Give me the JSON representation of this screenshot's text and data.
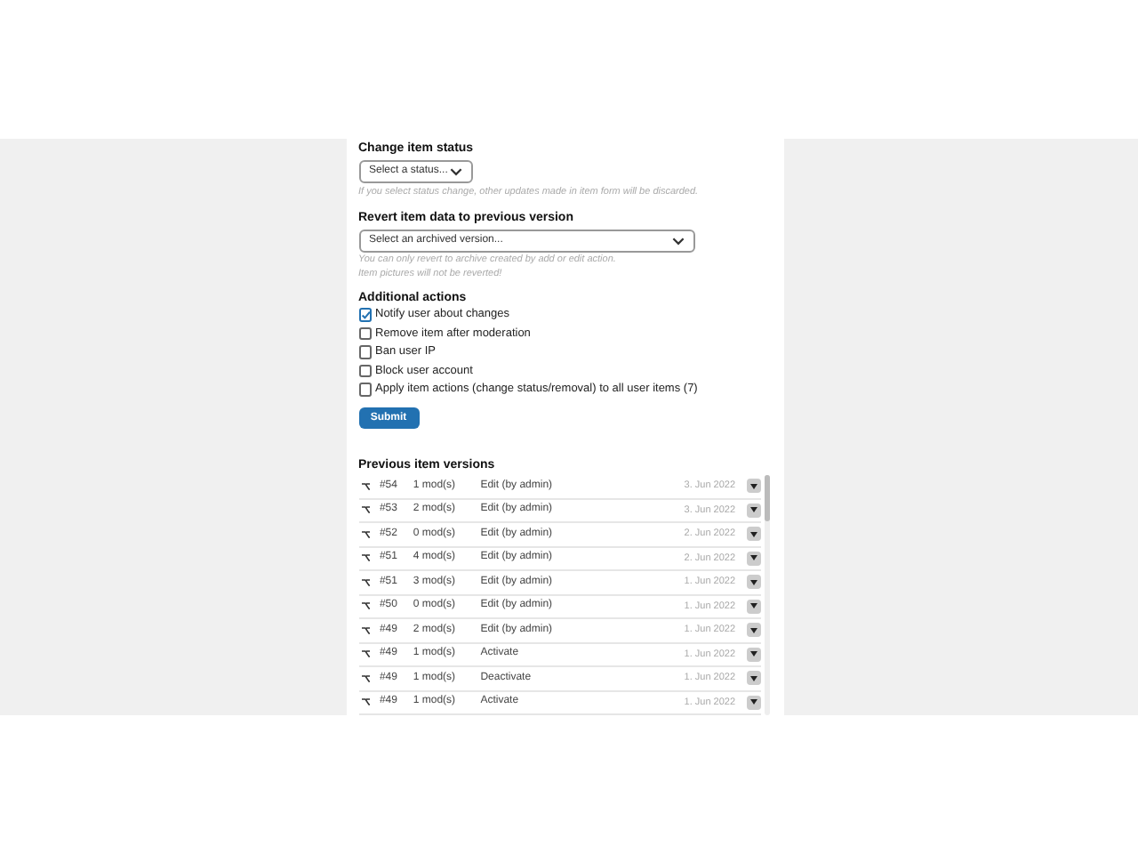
{
  "status": {
    "label": "Change item status",
    "placeholder": "Select a status...",
    "hint": "If you select status change, other updates made in item form will be discarded."
  },
  "revert": {
    "label": "Revert item data to previous version",
    "placeholder": "Select an archived version...",
    "hint_lines": [
      "You can only revert to archive created by add or edit action.",
      "Item pictures will not be reverted!"
    ]
  },
  "actions": {
    "label": "Additional actions",
    "items": [
      {
        "label": "Notify user about changes",
        "checked": true
      },
      {
        "label": "Remove item after moderation",
        "checked": false
      },
      {
        "label": "Ban user IP",
        "checked": false
      },
      {
        "label": "Block user account",
        "checked": false
      },
      {
        "label": "Apply item actions (change status/removal) to all user items (7)",
        "checked": false
      }
    ]
  },
  "submit": "Submit",
  "versions": {
    "title": "Previous item versions",
    "rows": [
      {
        "id": "#54",
        "mods": "1 mod(s)",
        "action": "Edit (by admin)",
        "date": "3. Jun 2022"
      },
      {
        "id": "#53",
        "mods": "2 mod(s)",
        "action": "Edit (by admin)",
        "date": "3. Jun 2022"
      },
      {
        "id": "#52",
        "mods": "0 mod(s)",
        "action": "Edit (by admin)",
        "date": "2. Jun 2022"
      },
      {
        "id": "#51",
        "mods": "4 mod(s)",
        "action": "Edit (by admin)",
        "date": "2. Jun 2022"
      },
      {
        "id": "#51",
        "mods": "3 mod(s)",
        "action": "Edit (by admin)",
        "date": "1. Jun 2022"
      },
      {
        "id": "#50",
        "mods": "0 mod(s)",
        "action": "Edit (by admin)",
        "date": "1. Jun 2022"
      },
      {
        "id": "#49",
        "mods": "2 mod(s)",
        "action": "Edit (by admin)",
        "date": "1. Jun 2022"
      },
      {
        "id": "#49",
        "mods": "1 mod(s)",
        "action": "Activate",
        "date": "1. Jun 2022"
      },
      {
        "id": "#49",
        "mods": "1 mod(s)",
        "action": "Deactivate",
        "date": "1. Jun 2022"
      },
      {
        "id": "#49",
        "mods": "1 mod(s)",
        "action": "Activate",
        "date": "1. Jun 2022"
      }
    ]
  }
}
